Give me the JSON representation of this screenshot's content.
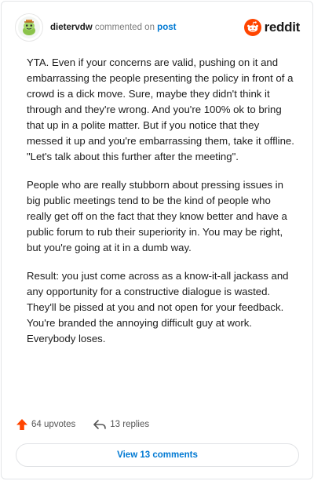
{
  "header": {
    "username": "dietervdw",
    "action_text": "commented on",
    "target_link": "post",
    "brand": "reddit"
  },
  "comment": {
    "paragraphs": [
      "YTA. Even if your concerns are valid, pushing on it and embarrassing the people presenting the policy in front of a crowd is a dick move. Sure, maybe they didn't think it through and they're wrong. And you're 100% ok to bring that up in a polite matter. But if you notice that they messed it up and you're embarrassing them, take it offline. \"Let's talk about this further after the meeting\".",
      "People who are really stubborn about pressing issues in big public meetings tend to be the kind of people who really get off on the fact that they know better and have a public forum to rub their superiority in. You may be right, but you're going at it in a dumb way.",
      "Result: you just come across as a know-it-all jackass and any opportunity for a constructive dialogue is wasted. They'll be pissed at you and not open for your feedback. You're branded the annoying difficult guy at work. Everybody loses."
    ]
  },
  "actions": {
    "upvotes": "64 upvotes",
    "replies": "13 replies"
  },
  "view_comments_label": "View 13 comments",
  "icons": {
    "upvote": "upvote-arrow-icon",
    "reply": "reply-arrow-icon",
    "logo": "reddit-snoo-icon",
    "avatar": "user-avatar-icon"
  },
  "colors": {
    "accent_blue": "#0079d3",
    "reddit_orange": "#ff4500"
  }
}
